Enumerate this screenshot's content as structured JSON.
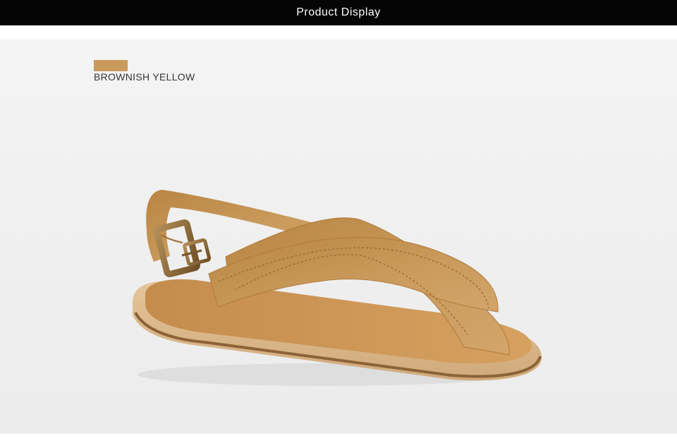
{
  "header": {
    "title": "Product Display"
  },
  "product": {
    "color_name": "BROWNISH YELLOW",
    "color_hex": "#c99a5b",
    "image_subject": "sandal"
  },
  "colors": {
    "header_bg": "#050505",
    "header_text": "#ffffff",
    "stage_bg": "#efefef",
    "leather": "#c99a5b",
    "sole": "#d7b792",
    "buckle": "#8f6a37"
  }
}
